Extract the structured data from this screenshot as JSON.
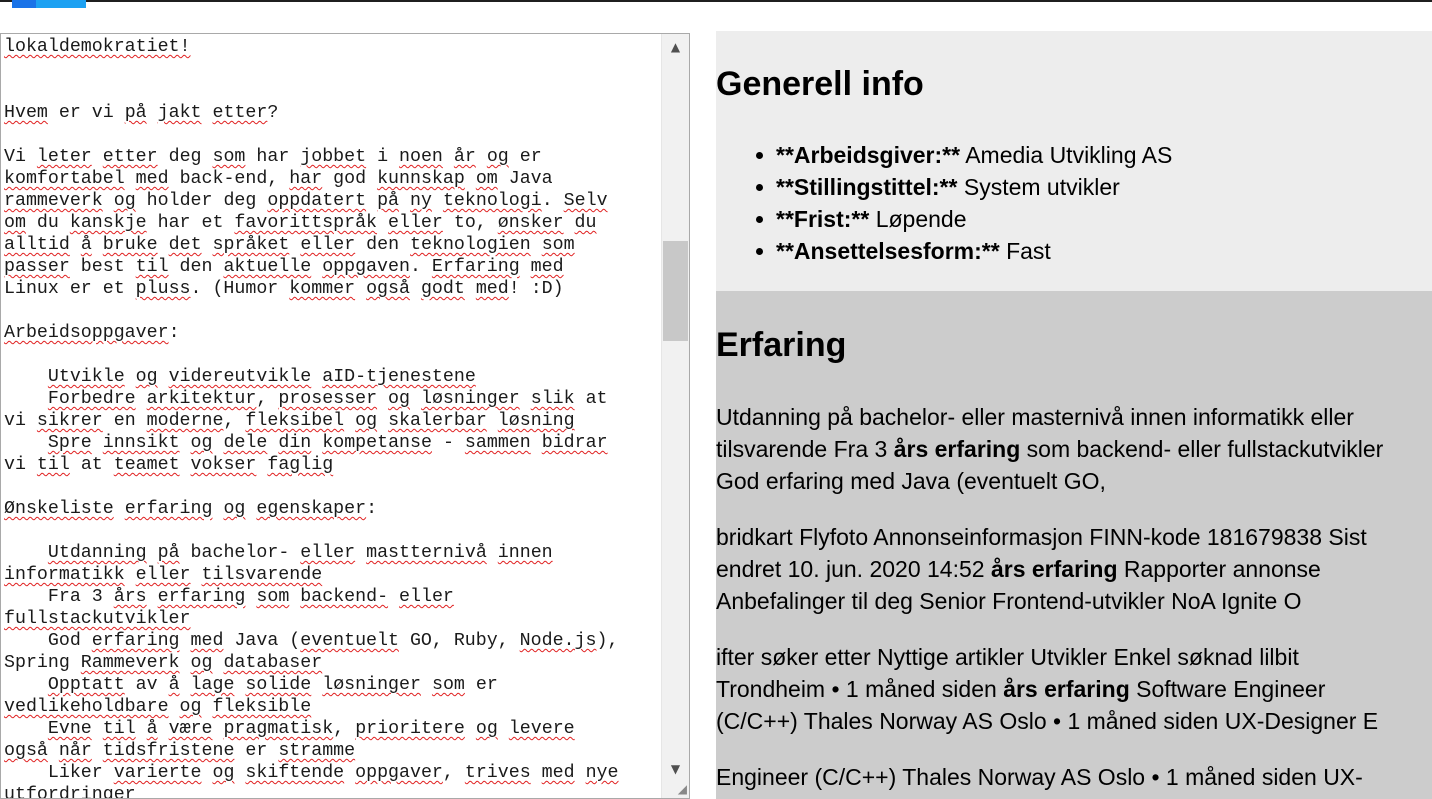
{
  "editor": {
    "lines": [
      [
        {
          "t": "lokaldemokratiet!",
          "s": true
        }
      ],
      [],
      [],
      [
        {
          "t": "Hvem",
          "s": true
        },
        {
          "t": " er vi "
        },
        {
          "t": "på",
          "s": true
        },
        {
          "t": " "
        },
        {
          "t": "jakt",
          "s": true
        },
        {
          "t": " "
        },
        {
          "t": "etter",
          "s": true
        },
        {
          "t": "?"
        }
      ],
      [],
      [
        {
          "t": "Vi "
        },
        {
          "t": "leter",
          "s": true
        },
        {
          "t": " "
        },
        {
          "t": "etter",
          "s": true
        },
        {
          "t": " deg "
        },
        {
          "t": "som",
          "s": true
        },
        {
          "t": " har "
        },
        {
          "t": "jobbet",
          "s": true
        },
        {
          "t": " i "
        },
        {
          "t": "noen",
          "s": true
        },
        {
          "t": " "
        },
        {
          "t": "år",
          "s": true
        },
        {
          "t": " "
        },
        {
          "t": "og",
          "s": true
        },
        {
          "t": " er"
        }
      ],
      [
        {
          "t": "komfortabel",
          "s": true
        },
        {
          "t": " "
        },
        {
          "t": "med",
          "s": true
        },
        {
          "t": " back-end, "
        },
        {
          "t": "har",
          "s": true
        },
        {
          "t": " god "
        },
        {
          "t": "kunnskap",
          "s": true
        },
        {
          "t": " "
        },
        {
          "t": "om",
          "s": true
        },
        {
          "t": " Java"
        }
      ],
      [
        {
          "t": "rammeverk",
          "s": true
        },
        {
          "t": " "
        },
        {
          "t": "og",
          "s": true
        },
        {
          "t": " holder deg "
        },
        {
          "t": "oppdatert",
          "s": true
        },
        {
          "t": " "
        },
        {
          "t": "på",
          "s": true
        },
        {
          "t": " "
        },
        {
          "t": "ny",
          "s": true
        },
        {
          "t": " "
        },
        {
          "t": "teknologi",
          "s": true
        },
        {
          "t": ". "
        },
        {
          "t": "Selv",
          "s": true
        }
      ],
      [
        {
          "t": "om",
          "s": true
        },
        {
          "t": " du "
        },
        {
          "t": "kanskje",
          "s": true
        },
        {
          "t": " har et "
        },
        {
          "t": "favorittspråk",
          "s": true
        },
        {
          "t": " "
        },
        {
          "t": "eller",
          "s": true
        },
        {
          "t": " to, "
        },
        {
          "t": "ønsker",
          "s": true
        },
        {
          "t": " "
        },
        {
          "t": "du",
          "s": true
        }
      ],
      [
        {
          "t": "alltid",
          "s": true
        },
        {
          "t": " "
        },
        {
          "t": "å",
          "s": true
        },
        {
          "t": " "
        },
        {
          "t": "bruke",
          "s": true
        },
        {
          "t": " "
        },
        {
          "t": "det",
          "s": true
        },
        {
          "t": " "
        },
        {
          "t": "språket",
          "s": true
        },
        {
          "t": " "
        },
        {
          "t": "eller",
          "s": true
        },
        {
          "t": " den "
        },
        {
          "t": "teknologien",
          "s": true
        },
        {
          "t": " "
        },
        {
          "t": "som",
          "s": true
        }
      ],
      [
        {
          "t": "passer",
          "s": true
        },
        {
          "t": " best "
        },
        {
          "t": "til",
          "s": true
        },
        {
          "t": " den "
        },
        {
          "t": "aktuelle",
          "s": true
        },
        {
          "t": " "
        },
        {
          "t": "oppgaven",
          "s": true
        },
        {
          "t": ". "
        },
        {
          "t": "Erfaring",
          "s": true
        },
        {
          "t": " "
        },
        {
          "t": "med",
          "s": true
        }
      ],
      [
        {
          "t": "Linux er et "
        },
        {
          "t": "pluss",
          "s": true
        },
        {
          "t": ". (Humor "
        },
        {
          "t": "kommer",
          "s": true
        },
        {
          "t": " "
        },
        {
          "t": "også",
          "s": true
        },
        {
          "t": " "
        },
        {
          "t": "godt",
          "s": true
        },
        {
          "t": " "
        },
        {
          "t": "med",
          "s": true
        },
        {
          "t": "! :D)"
        }
      ],
      [],
      [
        {
          "t": "Arbeidsoppgaver",
          "s": true
        },
        {
          "t": ":"
        }
      ],
      [],
      [
        {
          "t": "    "
        },
        {
          "t": "Utvikle",
          "s": true
        },
        {
          "t": " "
        },
        {
          "t": "og",
          "s": true
        },
        {
          "t": " "
        },
        {
          "t": "videreutvikle",
          "s": true
        },
        {
          "t": " "
        },
        {
          "t": "aID-tjenestene",
          "s": true
        }
      ],
      [
        {
          "t": "    "
        },
        {
          "t": "Forbedre",
          "s": true
        },
        {
          "t": " "
        },
        {
          "t": "arkitektur",
          "s": true
        },
        {
          "t": ", "
        },
        {
          "t": "prosesser",
          "s": true
        },
        {
          "t": " "
        },
        {
          "t": "og",
          "s": true
        },
        {
          "t": " "
        },
        {
          "t": "løsninger",
          "s": true
        },
        {
          "t": " "
        },
        {
          "t": "slik",
          "s": true
        },
        {
          "t": " at"
        }
      ],
      [
        {
          "t": "vi "
        },
        {
          "t": "sikrer",
          "s": true
        },
        {
          "t": " en "
        },
        {
          "t": "moderne",
          "s": true
        },
        {
          "t": ", "
        },
        {
          "t": "fleksibel",
          "s": true
        },
        {
          "t": " "
        },
        {
          "t": "og",
          "s": true
        },
        {
          "t": " "
        },
        {
          "t": "skalerbar",
          "s": true
        },
        {
          "t": " "
        },
        {
          "t": "løsning",
          "s": true
        }
      ],
      [
        {
          "t": "    "
        },
        {
          "t": "Spre",
          "s": true
        },
        {
          "t": " "
        },
        {
          "t": "innsikt",
          "s": true
        },
        {
          "t": " "
        },
        {
          "t": "og",
          "s": true
        },
        {
          "t": " "
        },
        {
          "t": "dele",
          "s": true
        },
        {
          "t": " "
        },
        {
          "t": "din",
          "s": true
        },
        {
          "t": " "
        },
        {
          "t": "kompetanse",
          "s": true
        },
        {
          "t": " - "
        },
        {
          "t": "sammen",
          "s": true
        },
        {
          "t": " "
        },
        {
          "t": "bidrar",
          "s": true
        }
      ],
      [
        {
          "t": "vi "
        },
        {
          "t": "til",
          "s": true
        },
        {
          "t": " at "
        },
        {
          "t": "teamet",
          "s": true
        },
        {
          "t": " "
        },
        {
          "t": "vokser",
          "s": true
        },
        {
          "t": " "
        },
        {
          "t": "faglig",
          "s": true
        }
      ],
      [],
      [
        {
          "t": "Ønskeliste",
          "s": true
        },
        {
          "t": " "
        },
        {
          "t": "erfaring",
          "s": true
        },
        {
          "t": " "
        },
        {
          "t": "og",
          "s": true
        },
        {
          "t": " "
        },
        {
          "t": "egenskaper",
          "s": true
        },
        {
          "t": ":"
        }
      ],
      [],
      [
        {
          "t": "    "
        },
        {
          "t": "Utdanning",
          "s": true
        },
        {
          "t": " "
        },
        {
          "t": "på",
          "s": true
        },
        {
          "t": " bachelor- "
        },
        {
          "t": "eller",
          "s": true
        },
        {
          "t": " "
        },
        {
          "t": "mastternivå",
          "s": true
        },
        {
          "t": " "
        },
        {
          "t": "innen",
          "s": true
        }
      ],
      [
        {
          "t": "informatikk",
          "s": true
        },
        {
          "t": " "
        },
        {
          "t": "eller",
          "s": true
        },
        {
          "t": " "
        },
        {
          "t": "tilsvarende",
          "s": true
        }
      ],
      [
        {
          "t": "    Fra 3 "
        },
        {
          "t": "års",
          "s": true
        },
        {
          "t": " "
        },
        {
          "t": "erfaring",
          "s": true
        },
        {
          "t": " "
        },
        {
          "t": "som",
          "s": true
        },
        {
          "t": " "
        },
        {
          "t": "backend-",
          "s": true
        },
        {
          "t": " "
        },
        {
          "t": "eller",
          "s": true
        }
      ],
      [
        {
          "t": "fullstackutvikler",
          "s": true
        }
      ],
      [
        {
          "t": "    God "
        },
        {
          "t": "erfaring",
          "s": true
        },
        {
          "t": " "
        },
        {
          "t": "med",
          "s": true
        },
        {
          "t": " Java ("
        },
        {
          "t": "eventuelt",
          "s": true
        },
        {
          "t": " GO, Ruby, "
        },
        {
          "t": "Node.js",
          "s": true
        },
        {
          "t": "),"
        }
      ],
      [
        {
          "t": "Spring "
        },
        {
          "t": "Rammeverk",
          "s": true
        },
        {
          "t": " "
        },
        {
          "t": "og",
          "s": true
        },
        {
          "t": " "
        },
        {
          "t": "databaser",
          "s": true
        }
      ],
      [
        {
          "t": "    "
        },
        {
          "t": "Opptatt",
          "s": true
        },
        {
          "t": " av "
        },
        {
          "t": "å",
          "s": true
        },
        {
          "t": " "
        },
        {
          "t": "lage",
          "s": true
        },
        {
          "t": " "
        },
        {
          "t": "solide",
          "s": true
        },
        {
          "t": " "
        },
        {
          "t": "løsninger",
          "s": true
        },
        {
          "t": " "
        },
        {
          "t": "som",
          "s": true
        },
        {
          "t": " er"
        }
      ],
      [
        {
          "t": "vedlikeholdbare",
          "s": true
        },
        {
          "t": " "
        },
        {
          "t": "og",
          "s": true
        },
        {
          "t": " "
        },
        {
          "t": "fleksible",
          "s": true
        }
      ],
      [
        {
          "t": "    "
        },
        {
          "t": "Evne",
          "s": true
        },
        {
          "t": " "
        },
        {
          "t": "til",
          "s": true
        },
        {
          "t": " "
        },
        {
          "t": "å",
          "s": true
        },
        {
          "t": " "
        },
        {
          "t": "være",
          "s": true
        },
        {
          "t": " "
        },
        {
          "t": "pragmatisk",
          "s": true
        },
        {
          "t": ", "
        },
        {
          "t": "prioritere",
          "s": true
        },
        {
          "t": " "
        },
        {
          "t": "og",
          "s": true
        },
        {
          "t": " "
        },
        {
          "t": "levere",
          "s": true
        }
      ],
      [
        {
          "t": "også",
          "s": true
        },
        {
          "t": " "
        },
        {
          "t": "når",
          "s": true
        },
        {
          "t": " "
        },
        {
          "t": "tidsfristene",
          "s": true
        },
        {
          "t": " er "
        },
        {
          "t": "stramme",
          "s": true
        }
      ],
      [
        {
          "t": "    Liker "
        },
        {
          "t": "varierte",
          "s": true
        },
        {
          "t": " "
        },
        {
          "t": "og",
          "s": true
        },
        {
          "t": " "
        },
        {
          "t": "skiftende",
          "s": true
        },
        {
          "t": " "
        },
        {
          "t": "oppgaver",
          "s": true
        },
        {
          "t": ", "
        },
        {
          "t": "trives",
          "s": true
        },
        {
          "t": " "
        },
        {
          "t": "med",
          "s": true
        },
        {
          "t": " "
        },
        {
          "t": "nye",
          "s": true
        }
      ],
      [
        {
          "t": "utfordringer",
          "s": true
        }
      ]
    ],
    "scroll_up_icon": "▲",
    "scroll_down_icon": "▼",
    "resize_icon": "◢"
  },
  "preview": {
    "general_heading": "Generell info",
    "info_items": [
      {
        "label": "**Arbeidsgiver:**",
        "value": " Amedia Utvikling AS"
      },
      {
        "label": "**Stillingstittel:**",
        "value": " System utvikler"
      },
      {
        "label": "**Frist:**",
        "value": " Løpende"
      },
      {
        "label": "**Ansettelsesform:**",
        "value": " Fast"
      }
    ],
    "experience_heading": "Erfaring",
    "paragraphs": [
      [
        {
          "t": "Utdanning på bachelor- eller masternivå innen informatikk eller"
        },
        {
          "br": true
        },
        {
          "t": "tilsvarende Fra 3 "
        },
        {
          "t": "års erfaring",
          "b": true
        },
        {
          "t": " som backend- eller fullstackutvikler"
        },
        {
          "br": true
        },
        {
          "t": "God erfaring med Java (eventuelt GO,"
        }
      ],
      [
        {
          "t": "bridkart Flyfoto Annonseinformasjon FINN-kode 181679838 Sist"
        },
        {
          "br": true
        },
        {
          "t": "endret 10. jun. 2020 14:52 "
        },
        {
          "t": "års erfaring",
          "b": true
        },
        {
          "t": " Rapporter annonse"
        },
        {
          "br": true
        },
        {
          "t": "Anbefalinger til deg Senior Frontend-utvikler NoA Ignite O"
        }
      ],
      [
        {
          "t": "ifter søker etter Nyttige artikler Utvikler Enkel søknad lilbit"
        },
        {
          "br": true
        },
        {
          "t": "Trondheim • 1 måned siden "
        },
        {
          "t": "års erfaring",
          "b": true
        },
        {
          "t": " Software Engineer"
        },
        {
          "br": true
        },
        {
          "t": "(C/C++) Thales Norway AS Oslo • 1 måned siden UX-Designer E"
        }
      ],
      [
        {
          "t": "Engineer (C/C++) Thales Norway AS Oslo • 1 måned siden UX-"
        }
      ]
    ]
  }
}
